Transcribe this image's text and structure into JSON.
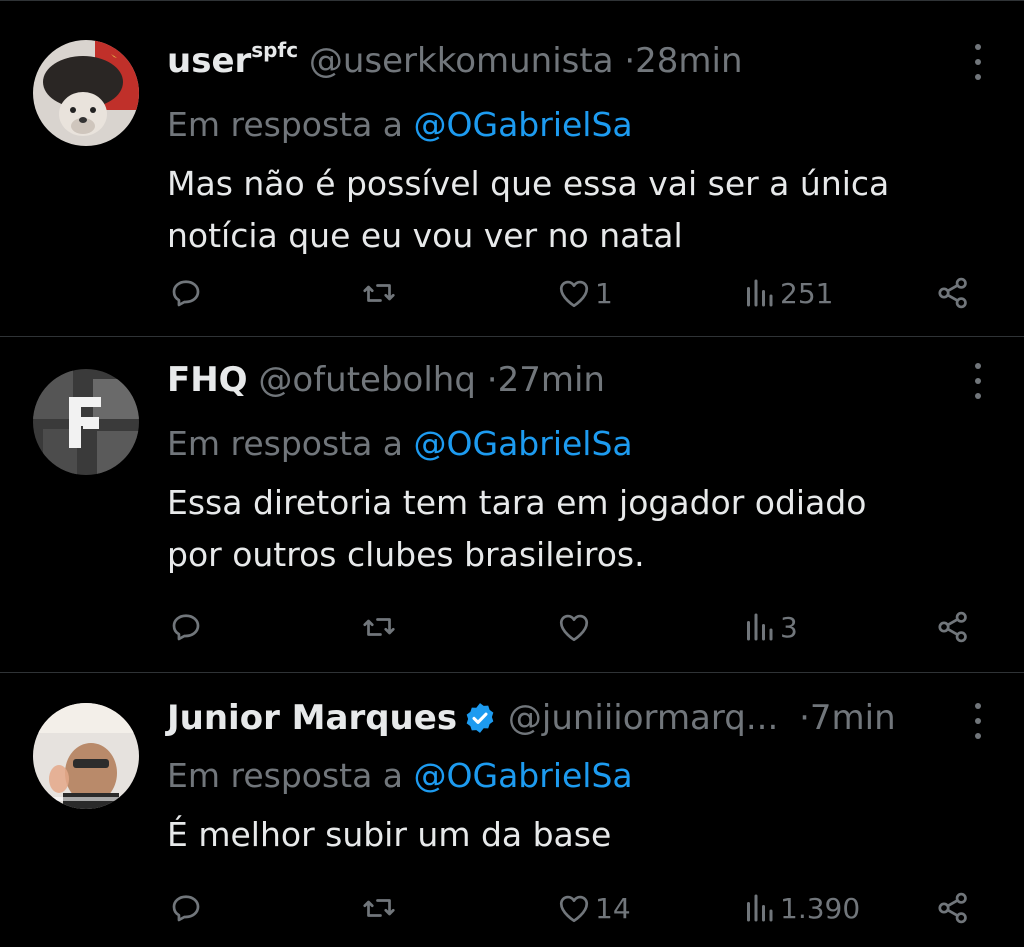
{
  "tweets": [
    {
      "name": "user",
      "name_sup": "spfc",
      "handle": "@userkkomunista",
      "sep": "·",
      "time": "28min",
      "verified": false,
      "reply_prefix": "Em resposta a",
      "reply_to": "@OGabrielSa",
      "text_lines": [
        "Mas não é possível que essa vai ser a única",
        "notícia que eu vou ver no natal"
      ],
      "counts": {
        "replies": "",
        "retweets": "",
        "likes": "1",
        "views": "251"
      }
    },
    {
      "name": "FHQ",
      "name_sup": "",
      "handle": "@ofutebolhq",
      "sep": "·",
      "time": "27min",
      "verified": false,
      "reply_prefix": "Em resposta a",
      "reply_to": "@OGabrielSa",
      "text_lines": [
        "Essa diretoria tem tara em jogador odiado",
        "por outros clubes brasileiros."
      ],
      "counts": {
        "replies": "",
        "retweets": "",
        "likes": "",
        "views": "3"
      }
    },
    {
      "name": "Junior Marques",
      "name_sup": "",
      "handle": "@juniiiormarq...",
      "sep": "·",
      "time": "7min",
      "verified": true,
      "reply_prefix": "Em resposta a",
      "reply_to": "@OGabrielSa",
      "text_lines": [
        "É melhor subir um da base"
      ],
      "counts": {
        "replies": "",
        "retweets": "",
        "likes": "14",
        "views": "1.390"
      }
    }
  ],
  "colors": {
    "background": "#000000",
    "text": "#e7e9ea",
    "muted": "#71767b",
    "link": "#1d9bf0",
    "divider": "#2f3336",
    "verified": "#1d9bf0"
  },
  "icons": [
    "reply-icon",
    "retweet-icon",
    "like-icon",
    "views-icon",
    "share-icon",
    "more-icon",
    "verified-badge-icon"
  ]
}
